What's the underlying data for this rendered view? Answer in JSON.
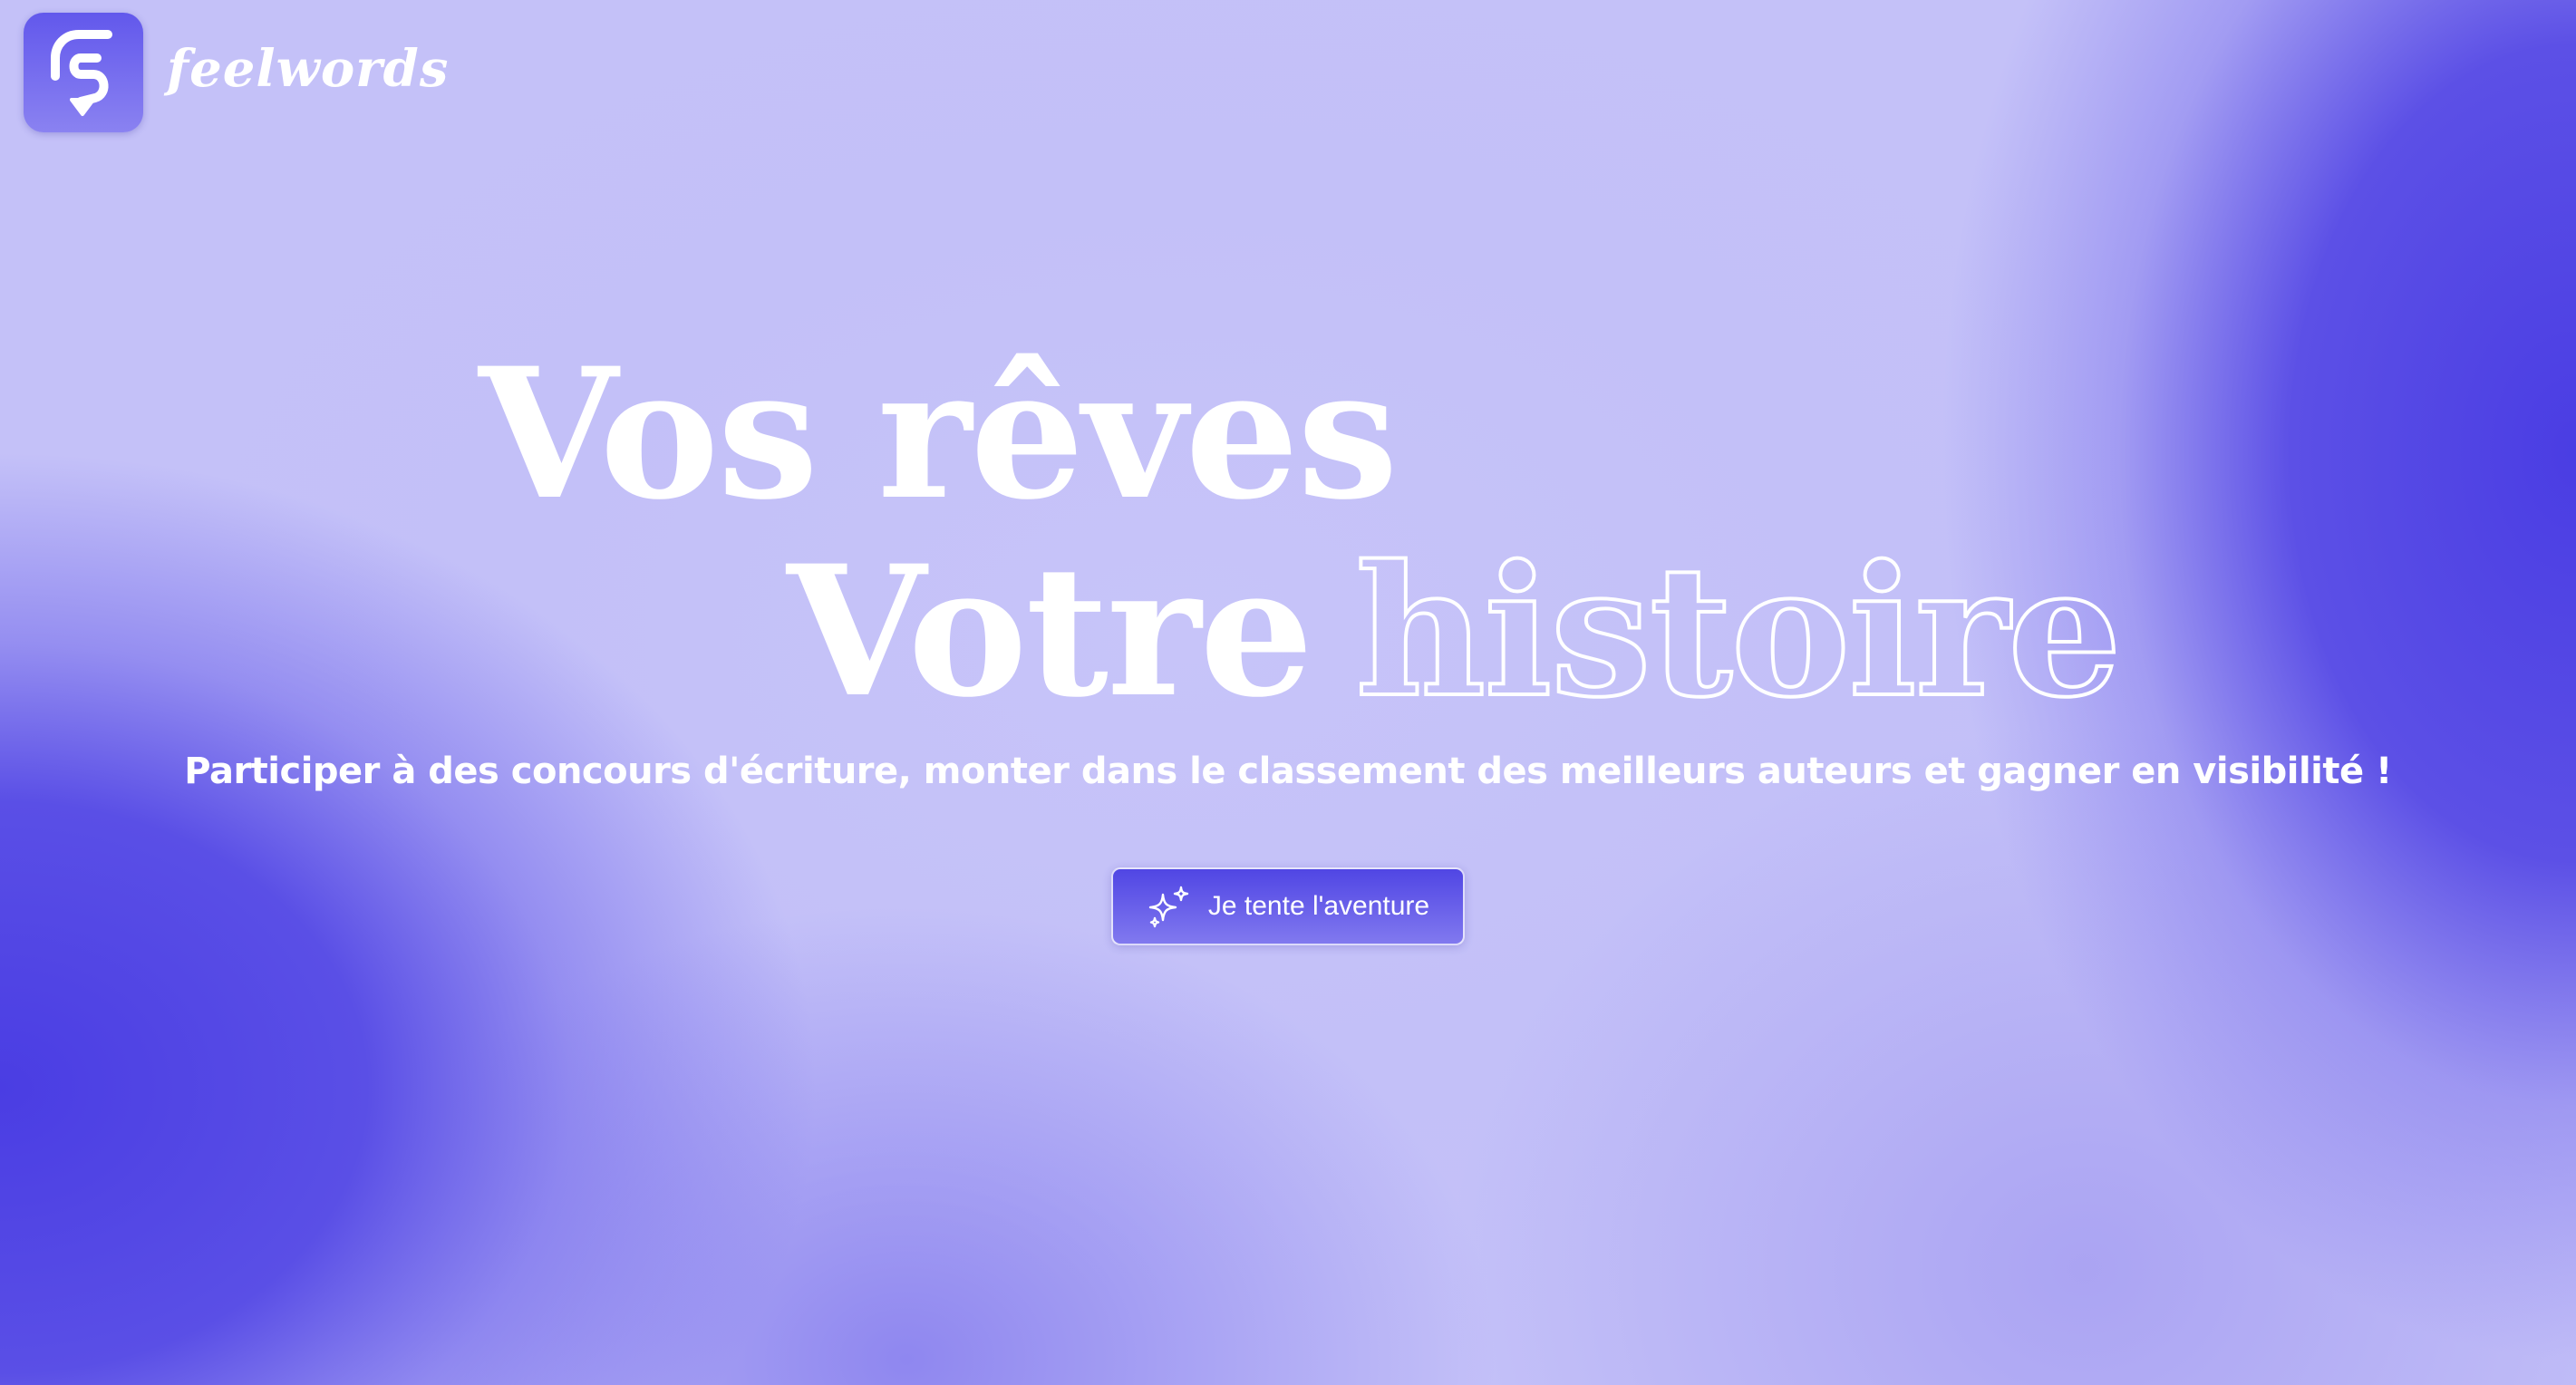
{
  "brand": {
    "name": "feelwords",
    "logo_icon": "feelwords-logo-icon"
  },
  "hero": {
    "line1": "Vos rêves",
    "line2_solid": "Votre",
    "line2_outline": "histoire",
    "subtitle": "Participer à des concours d'écriture, monter dans le classement des meilleurs auteurs et gagner en visibilité !"
  },
  "cta": {
    "label": "Je tente l'aventure",
    "icon": "sparkles-icon"
  },
  "colors": {
    "primary": "#4a3de3",
    "background": "#c4c1f8",
    "text": "#ffffff"
  }
}
